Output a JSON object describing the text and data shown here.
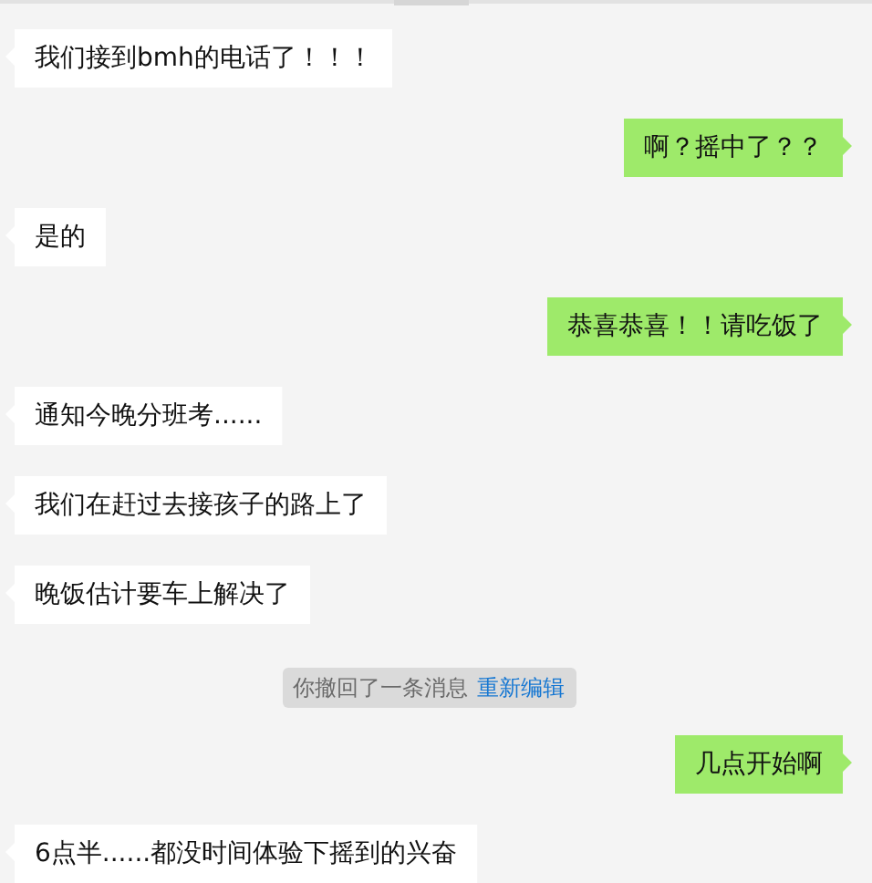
{
  "messages": [
    {
      "kind": "incoming",
      "text": "我们接到bmh的电话了！！！"
    },
    {
      "kind": "outgoing",
      "text": "啊？摇中了？？"
    },
    {
      "kind": "incoming",
      "text": "是的"
    },
    {
      "kind": "outgoing",
      "text": "恭喜恭喜！！请吃饭了"
    },
    {
      "kind": "incoming",
      "text": "通知今晚分班考......"
    },
    {
      "kind": "incoming",
      "text": "我们在赶过去接孩子的路上了"
    },
    {
      "kind": "incoming",
      "text": "晚饭估计要车上解决了"
    },
    {
      "kind": "system",
      "text": "你撤回了一条消息",
      "link": "重新编辑"
    },
    {
      "kind": "outgoing",
      "text": "几点开始啊"
    },
    {
      "kind": "incoming",
      "text": "6点半......都没时间体验下摇到的兴奋"
    }
  ]
}
